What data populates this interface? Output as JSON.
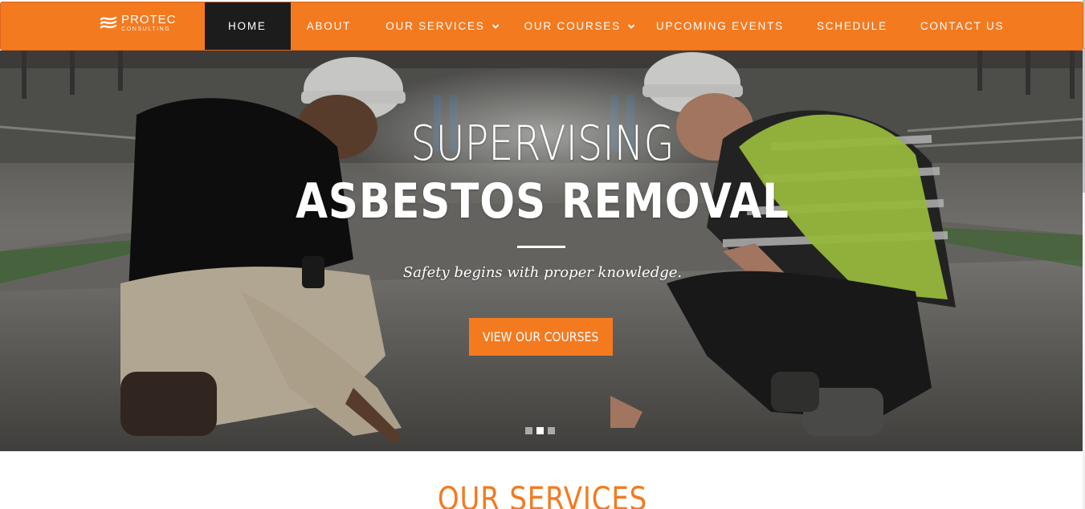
{
  "brand": {
    "name": "PROTEC",
    "sub": "CONSULTING",
    "accent_color": "#f47a20",
    "active_nav_bg": "#1c1c1c",
    "logo_icon": "waves-logo-icon"
  },
  "nav": {
    "items": [
      {
        "label": "HOME",
        "active": true
      },
      {
        "label": "ABOUT"
      },
      {
        "label": "OUR SERVICES",
        "dropdown": true
      },
      {
        "label": "OUR COURSES",
        "dropdown": true
      },
      {
        "label": "UPCOMING EVENTS"
      },
      {
        "label": "SCHEDULE"
      },
      {
        "label": "CONTACT US"
      }
    ]
  },
  "hero": {
    "title_light": "SUPERVISING",
    "title_bold": "ASBESTOS REMOVAL",
    "tagline": "Safety begins with proper knowledge.",
    "cta": "VIEW OUR COURSES",
    "slides_count": 3,
    "active_slide": 2
  },
  "services": {
    "title": "OUR SERVICES"
  }
}
